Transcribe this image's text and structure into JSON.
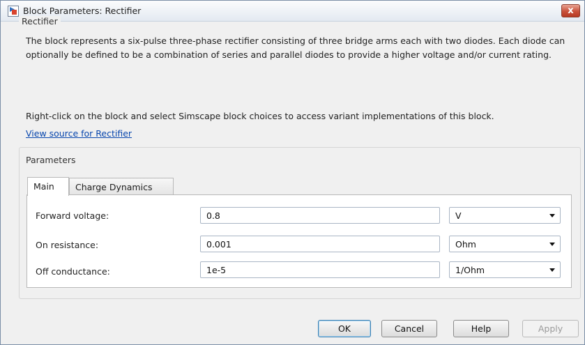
{
  "window": {
    "title": "Block Parameters: Rectifier",
    "close_label": "x"
  },
  "description": {
    "group_title": "Rectifier",
    "text": "The block represents a six-pulse three-phase rectifier consisting of three bridge arms each with two diodes. Each diode can optionally be defined to be a combination of series and parallel diodes to provide a higher voltage and/or current rating.",
    "text2": "Right-click on the block and select Simscape block choices to access variant implementations of this block.",
    "link": "View source for Rectifier"
  },
  "parameters": {
    "group_title": "Parameters",
    "tabs": [
      {
        "label": "Main",
        "active": true
      },
      {
        "label": "Charge Dynamics",
        "active": false
      }
    ],
    "rows": [
      {
        "label": "Forward voltage:",
        "value": "0.8",
        "unit": "V"
      },
      {
        "label": "On resistance:",
        "value": "0.001",
        "unit": "Ohm"
      },
      {
        "label": "Off conductance:",
        "value": "1e-5",
        "unit": "1/Ohm"
      }
    ]
  },
  "buttons": {
    "ok": "OK",
    "cancel": "Cancel",
    "help": "Help",
    "apply": "Apply"
  },
  "colors": {
    "link": "#0645ad",
    "close_button": "#c9503a",
    "default_button_border": "#3c7fb1"
  }
}
